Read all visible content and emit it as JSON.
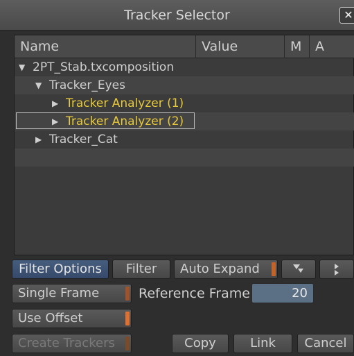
{
  "window": {
    "title": "Tracker Selector",
    "close_glyph": "✕"
  },
  "tree": {
    "columns": [
      "Name",
      "Value",
      "M",
      "A"
    ],
    "rows": [
      {
        "label": "2PT_Stab.txcomposition",
        "expanded": true,
        "highlight": false
      },
      {
        "label": "Tracker_Eyes",
        "expanded": true,
        "highlight": false
      },
      {
        "label": "Tracker Analyzer (1)",
        "expanded": false,
        "highlight": true
      },
      {
        "label": "Tracker Analyzer (2)",
        "expanded": false,
        "highlight": true,
        "selected": true
      },
      {
        "label": "Tracker_Cat",
        "expanded": false,
        "highlight": false
      }
    ]
  },
  "toolbar": {
    "filter_options": "Filter Options",
    "filter": "Filter",
    "auto_expand": "Auto Expand",
    "expand_icon": "expand-down-icon",
    "next_icon": "step-right-icon"
  },
  "frame": {
    "single_frame": "Single Frame",
    "reference_label": "Reference Frame",
    "reference_value": "20"
  },
  "options": {
    "use_offset": "Use Offset"
  },
  "actions": {
    "create_trackers": "Create Trackers",
    "copy": "Copy",
    "link": "Link",
    "cancel": "Cancel"
  },
  "colors": {
    "highlight_text": "#e8c93a",
    "accent": "#c2642a",
    "active_button": "#465e7e"
  }
}
